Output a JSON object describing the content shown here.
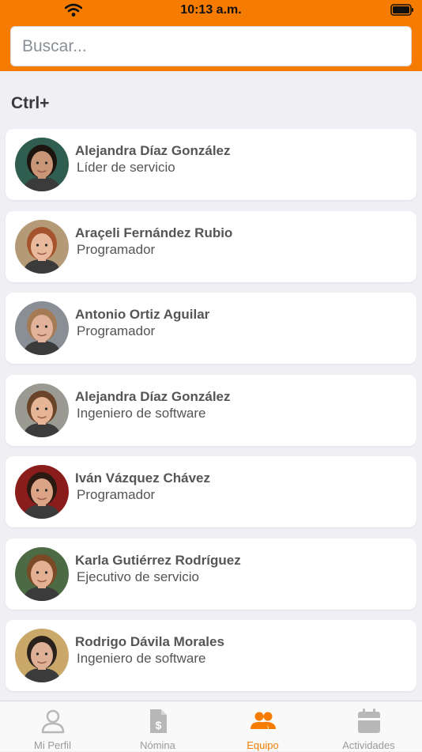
{
  "status": {
    "time": "10:13 a.m."
  },
  "search": {
    "placeholder": "Buscar..."
  },
  "section": {
    "title": "Ctrl+"
  },
  "team": [
    {
      "name": "Alejandra Díaz González",
      "role": "Líder de servicio",
      "avatar_bg": "#2f5d50",
      "skin": "#c99778",
      "hair": "#1d1410"
    },
    {
      "name": "Araçeli Fernández Rubio",
      "role": "Programador",
      "avatar_bg": "#b59a78",
      "skin": "#e8b99c",
      "hair": "#a5532c"
    },
    {
      "name": "Antonio Ortiz Aguilar",
      "role": "Programador",
      "avatar_bg": "#8a8f95",
      "skin": "#e2b39a",
      "hair": "#a57b56"
    },
    {
      "name": "Alejandra Díaz González",
      "role": "Ingeniero de software",
      "avatar_bg": "#9a9a92",
      "skin": "#e6b596",
      "hair": "#6a4428"
    },
    {
      "name": "Iván Vázquez Chávez",
      "role": "Programador",
      "avatar_bg": "#8b1c1c",
      "skin": "#dca486",
      "hair": "#2a1a12"
    },
    {
      "name": "Karla Gutiérrez Rodríguez",
      "role": "Ejecutivo de servicio",
      "avatar_bg": "#4c6a44",
      "skin": "#e3b094",
      "hair": "#7a4a26"
    },
    {
      "name": "Rodrigo Dávila Morales",
      "role": "Ingeniero de software",
      "avatar_bg": "#c9a86a",
      "skin": "#deb095",
      "hair": "#2b211c"
    }
  ],
  "tabs": [
    {
      "label": "Mi Perfil",
      "icon": "person-icon",
      "active": false
    },
    {
      "label": "Nómina",
      "icon": "payroll-document-icon",
      "active": false
    },
    {
      "label": "Equipo",
      "icon": "team-icon",
      "active": true
    },
    {
      "label": "Actividades",
      "icon": "calendar-icon",
      "active": false
    }
  ],
  "colors": {
    "accent": "#f57c00",
    "inactive": "#9a9a9a",
    "background": "#efeff4"
  }
}
